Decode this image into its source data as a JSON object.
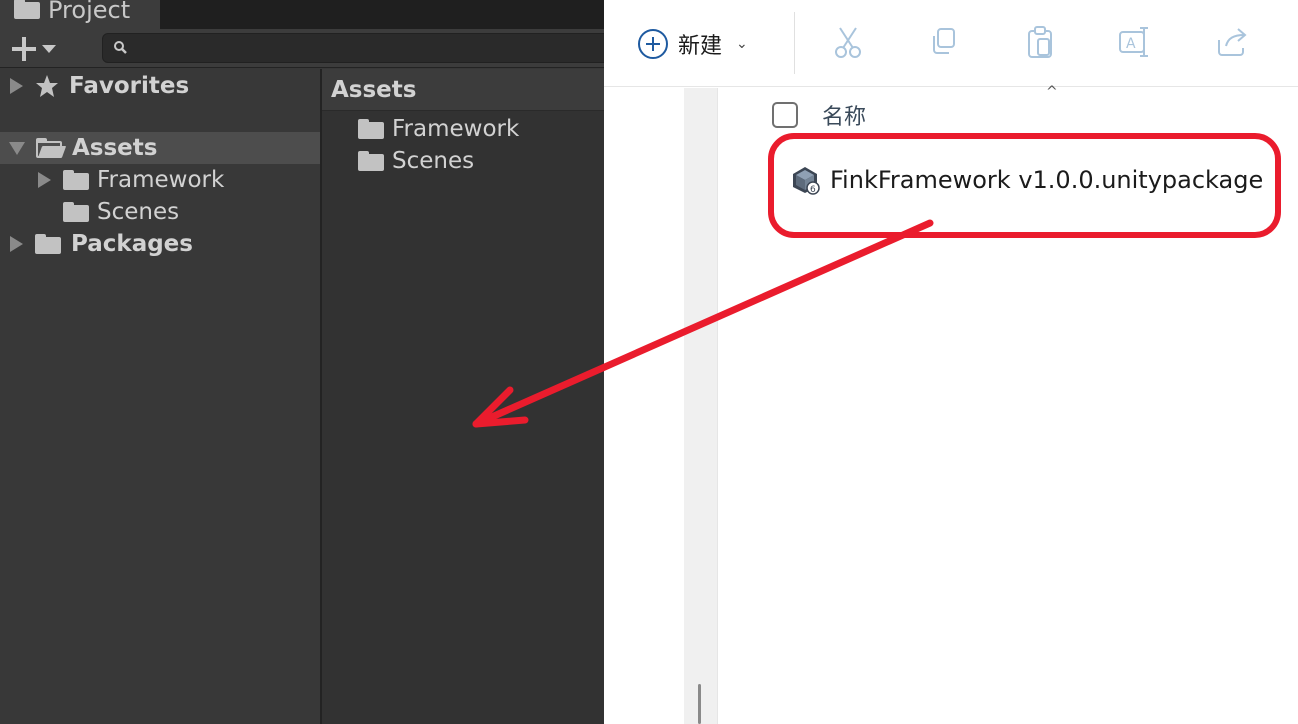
{
  "unity": {
    "tab_title": "Project",
    "tree": [
      {
        "label": "Favorites",
        "bold": true
      },
      {
        "label": "Assets",
        "bold": true
      },
      {
        "label": "Framework",
        "bold": false
      },
      {
        "label": "Scenes",
        "bold": false
      },
      {
        "label": "Packages",
        "bold": true
      }
    ],
    "breadcrumb": "Assets",
    "contents": [
      "Framework",
      "Scenes"
    ]
  },
  "explorer": {
    "new_label": "新建",
    "column_name": "名称",
    "file_name": "FinkFramework v1.0.0.unitypackage",
    "toolbar_icons": [
      "cut-icon",
      "copy-icon",
      "paste-icon",
      "rename-icon",
      "share-icon"
    ]
  },
  "colors": {
    "annotation": "#ea1c2d",
    "unity_bg": "#383838",
    "explorer_accent": "#1e5aa0"
  }
}
